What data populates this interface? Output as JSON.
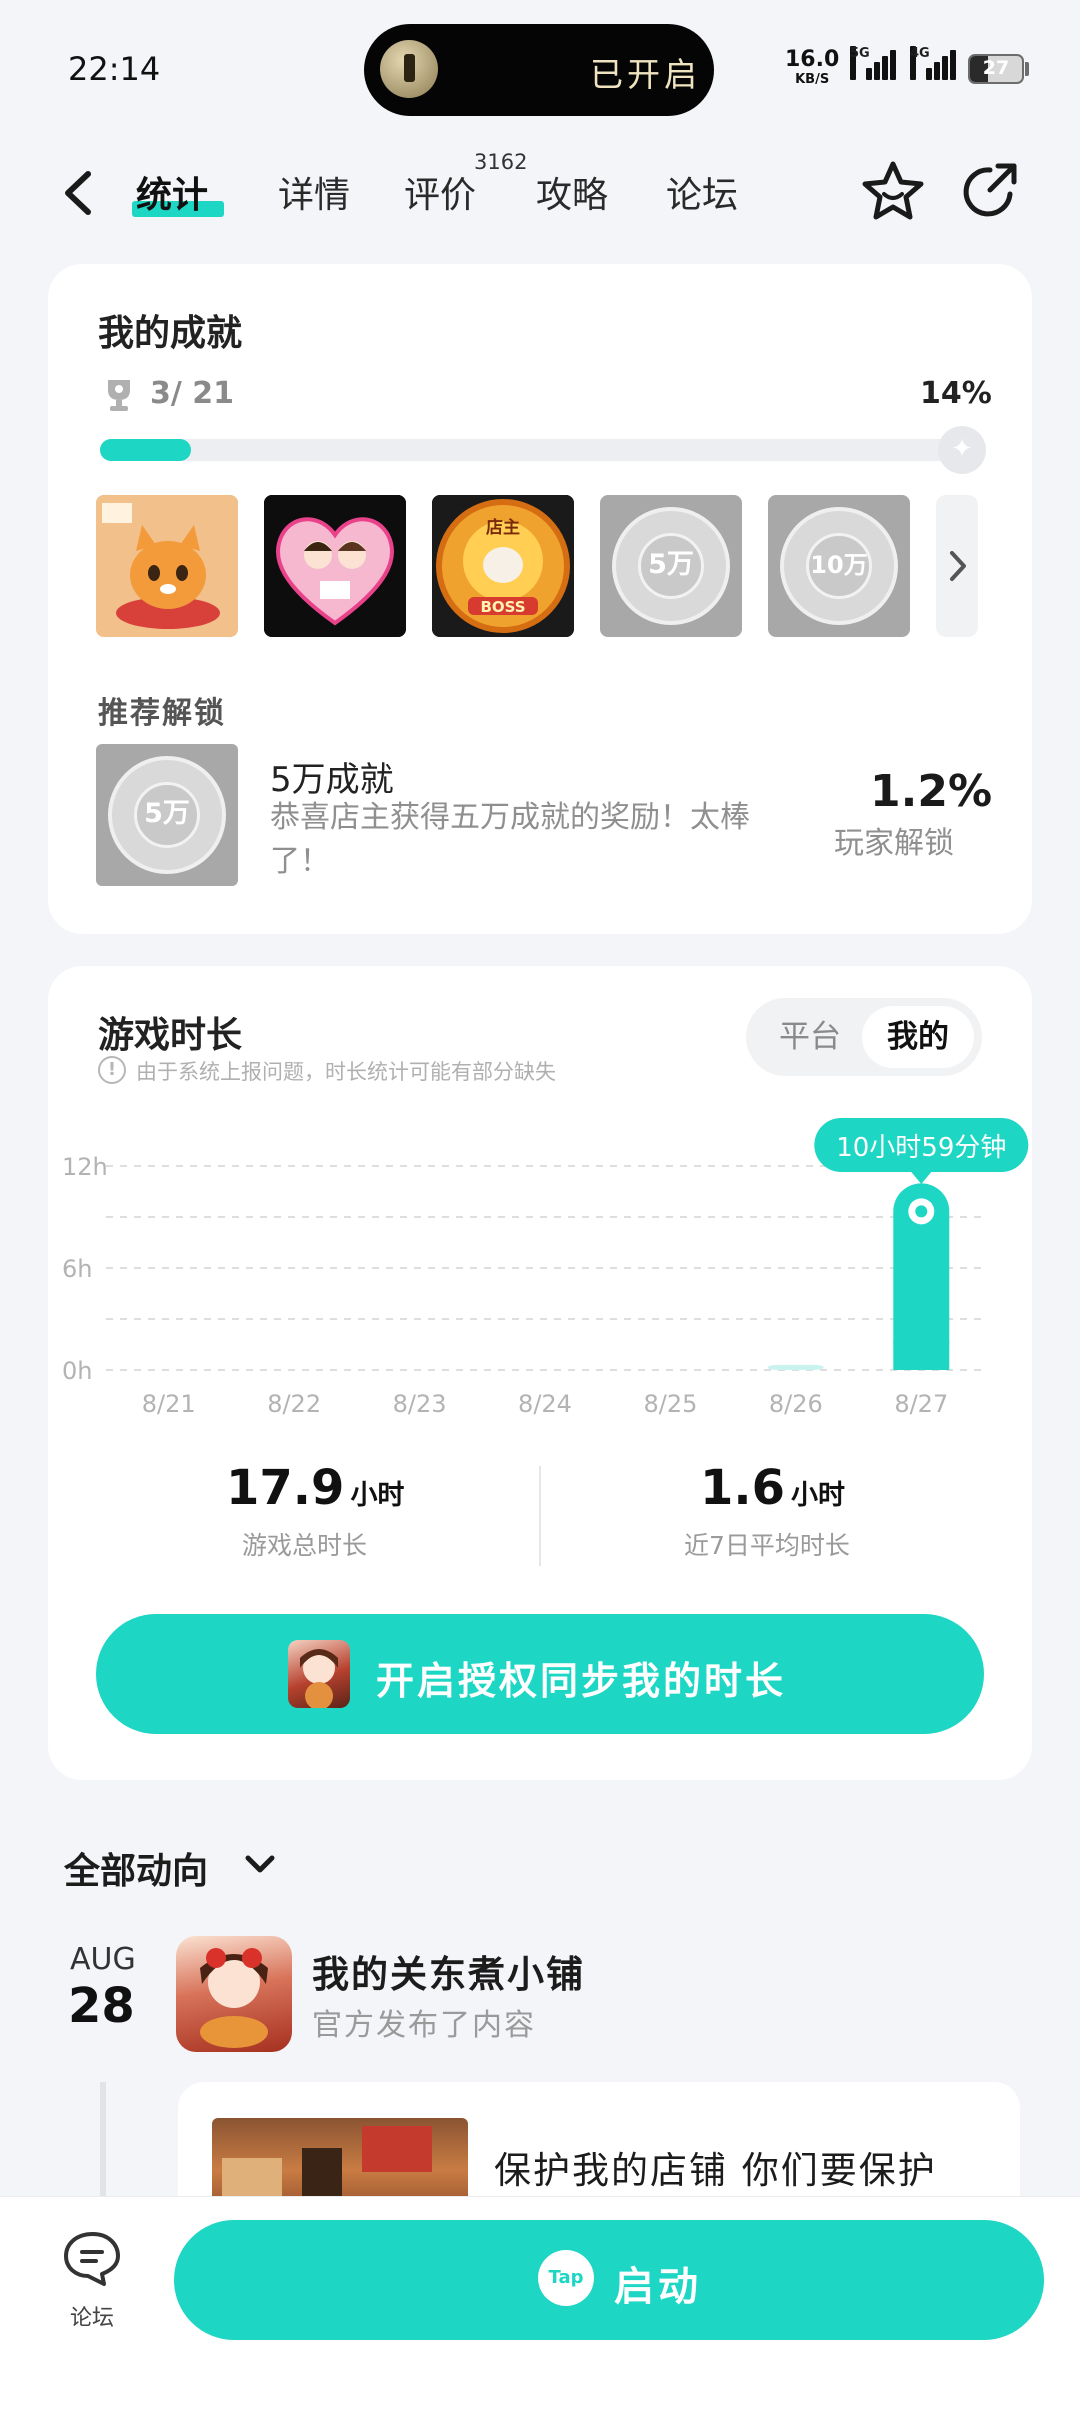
{
  "status_bar": {
    "time": "22:14",
    "flashlight_text": "已开启",
    "net_speed": "16.0",
    "net_unit": "KB/S",
    "signal_1": "5G",
    "signal_2": "4G",
    "battery": "27"
  },
  "nav": {
    "tabs": [
      {
        "label": "统计"
      },
      {
        "label": "详情"
      },
      {
        "label": "评价"
      },
      {
        "label": "攻略"
      },
      {
        "label": "论坛"
      }
    ],
    "review_count": "3162",
    "active_tab": "统计"
  },
  "achievements": {
    "title": "我的成就",
    "count": "3/ 21",
    "percent_label": "14%",
    "progress": 0.14,
    "badges": [
      {
        "name": "cat-badge",
        "locked": false
      },
      {
        "name": "heart-couple-badge",
        "locked": false
      },
      {
        "name": "boss-badge",
        "locked": false,
        "text": "BOSS",
        "top_text": "店主"
      },
      {
        "name": "coin-5wan-badge",
        "locked": true,
        "text": "5万"
      },
      {
        "name": "coin-10wan-badge",
        "locked": true,
        "text": "10万"
      }
    ],
    "recommended": {
      "section_title": "推荐解锁",
      "name": "5万成就",
      "description": "恭喜店主获得五万成就的奖励！太棒了！",
      "coin_text": "5万",
      "unlock_percent": "1.2%",
      "unlock_label": "玩家解锁"
    }
  },
  "playtime": {
    "title": "游戏时长",
    "notice": "由于系统上报问题，时长统计可能有部分缺失",
    "segments": [
      "平台",
      "我的"
    ],
    "active_segment": "我的",
    "tooltip": "10小时59分钟",
    "stats": [
      {
        "value": "17.9",
        "unit": "小时",
        "label": "游戏总时长"
      },
      {
        "value": "1.6",
        "unit": "小时",
        "label": "近7日平均时长"
      }
    ],
    "sync_button": "开启授权同步我的时长"
  },
  "chart_data": {
    "type": "bar",
    "categories": [
      "8/21",
      "8/22",
      "8/23",
      "8/24",
      "8/25",
      "8/26",
      "8/27"
    ],
    "values": [
      0,
      0,
      0,
      0,
      0,
      0.3,
      10.98
    ],
    "y_ticks": [
      "0h",
      "6h",
      "12h"
    ],
    "ylim": [
      0,
      12
    ],
    "grid": true,
    "highlight_index": 6,
    "accent": "#1dd6c4",
    "faint": "#c9f3ee"
  },
  "feed": {
    "filter_label": "全部动向",
    "month": "AUG",
    "day": "28",
    "game_name": "我的关东煮小铺",
    "game_sub": "官方发布了内容",
    "post_title": "保护我的店铺 你们要保护"
  },
  "bottom": {
    "forum_label": "论坛",
    "launch_icon": "Tap",
    "launch_label": "启动"
  },
  "colors": {
    "accent": "#1dd6c4",
    "background": "#f3f5f8"
  }
}
